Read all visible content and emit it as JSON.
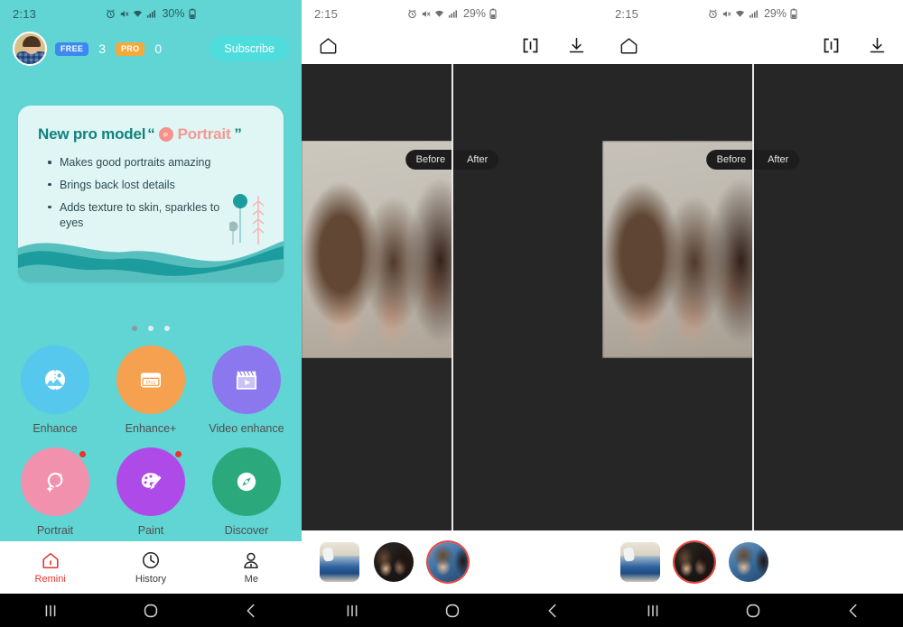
{
  "home": {
    "statusbar": {
      "time": "2:13",
      "battery": "30%",
      "icons": [
        "alarm-icon",
        "mute-icon",
        "wifi-icon",
        "signal-icon",
        "battery-icon"
      ]
    },
    "header": {
      "avatar_name": "user-avatar",
      "free_badge": "FREE",
      "free_count": "3",
      "pro_badge": "PRO",
      "pro_count": "0",
      "subscribe_label": "Subscribe"
    },
    "promo": {
      "title_prefix": "New pro model",
      "quote_open": "“",
      "quote_close": "”",
      "highlight": "Portrait",
      "bullets": [
        "Makes good portraits amazing",
        "Brings back lost details",
        "Adds texture to skin, sparkles to eyes"
      ],
      "card_bg": "#DFF6F5",
      "title_color": "#11827E",
      "highlight_color": "#F69993",
      "wave_dark": "#1C9C9C",
      "wave_light": "#58BFBF"
    },
    "carousel": {
      "total": 3,
      "active": 0
    },
    "features": [
      {
        "label": "Enhance",
        "icon": "enhance-icon",
        "color": "#56C7ED",
        "badge": false
      },
      {
        "label": "Enhance+",
        "icon": "enhance-plus-icon",
        "color": "#F5A14F",
        "badge": false
      },
      {
        "label": "Video enhance",
        "icon": "video-enhance-icon",
        "color": "#8B78EE",
        "badge": false
      },
      {
        "label": "Portrait",
        "icon": "portrait-icon",
        "color": "#F191AE",
        "badge": true
      },
      {
        "label": "Paint",
        "icon": "paint-icon",
        "color": "#AE4BE8",
        "badge": true
      },
      {
        "label": "Discover",
        "icon": "discover-icon",
        "color": "#2CA97C",
        "badge": false
      }
    ],
    "bottomnav": [
      {
        "label": "Remini",
        "icon": "home-icon",
        "active": true
      },
      {
        "label": "History",
        "icon": "clock-icon",
        "active": false
      },
      {
        "label": "Me",
        "icon": "person-icon",
        "active": false
      }
    ],
    "accent": "#E0352B",
    "bg": "#61D4D4"
  },
  "editor_left": {
    "statusbar": {
      "time": "2:15",
      "battery": "29%"
    },
    "toolbar": {
      "home": "home-icon",
      "compare": "compare-icon",
      "download": "download-icon"
    },
    "compare": {
      "before_label": "Before",
      "after_label": "After",
      "split_percent": 50
    },
    "handle": {
      "left_arrow": "‹",
      "right_arrow": "›"
    },
    "thumbnails": [
      {
        "name": "thumb-beach-photo",
        "shape": "square",
        "selected": false
      },
      {
        "name": "thumb-woman-photo",
        "shape": "circle",
        "selected": false
      },
      {
        "name": "thumb-kid-photo",
        "shape": "circle",
        "selected": true
      }
    ]
  },
  "editor_right": {
    "statusbar": {
      "time": "2:15",
      "battery": "29%"
    },
    "toolbar": {
      "home": "home-icon",
      "compare": "compare-icon",
      "download": "download-icon"
    },
    "compare": {
      "before_label": "Before",
      "after_label": "After",
      "split_percent": 50
    },
    "handle": {
      "left_arrow": "‹",
      "right_arrow": "›"
    },
    "thumbnails": [
      {
        "name": "thumb-beach-photo",
        "shape": "square",
        "selected": false
      },
      {
        "name": "thumb-woman-photo",
        "shape": "circle",
        "selected": true
      },
      {
        "name": "thumb-kid-photo",
        "shape": "circle",
        "selected": false
      }
    ]
  },
  "android_nav": {
    "recents": "recents-icon",
    "home": "home-circle-icon",
    "back": "back-icon"
  }
}
